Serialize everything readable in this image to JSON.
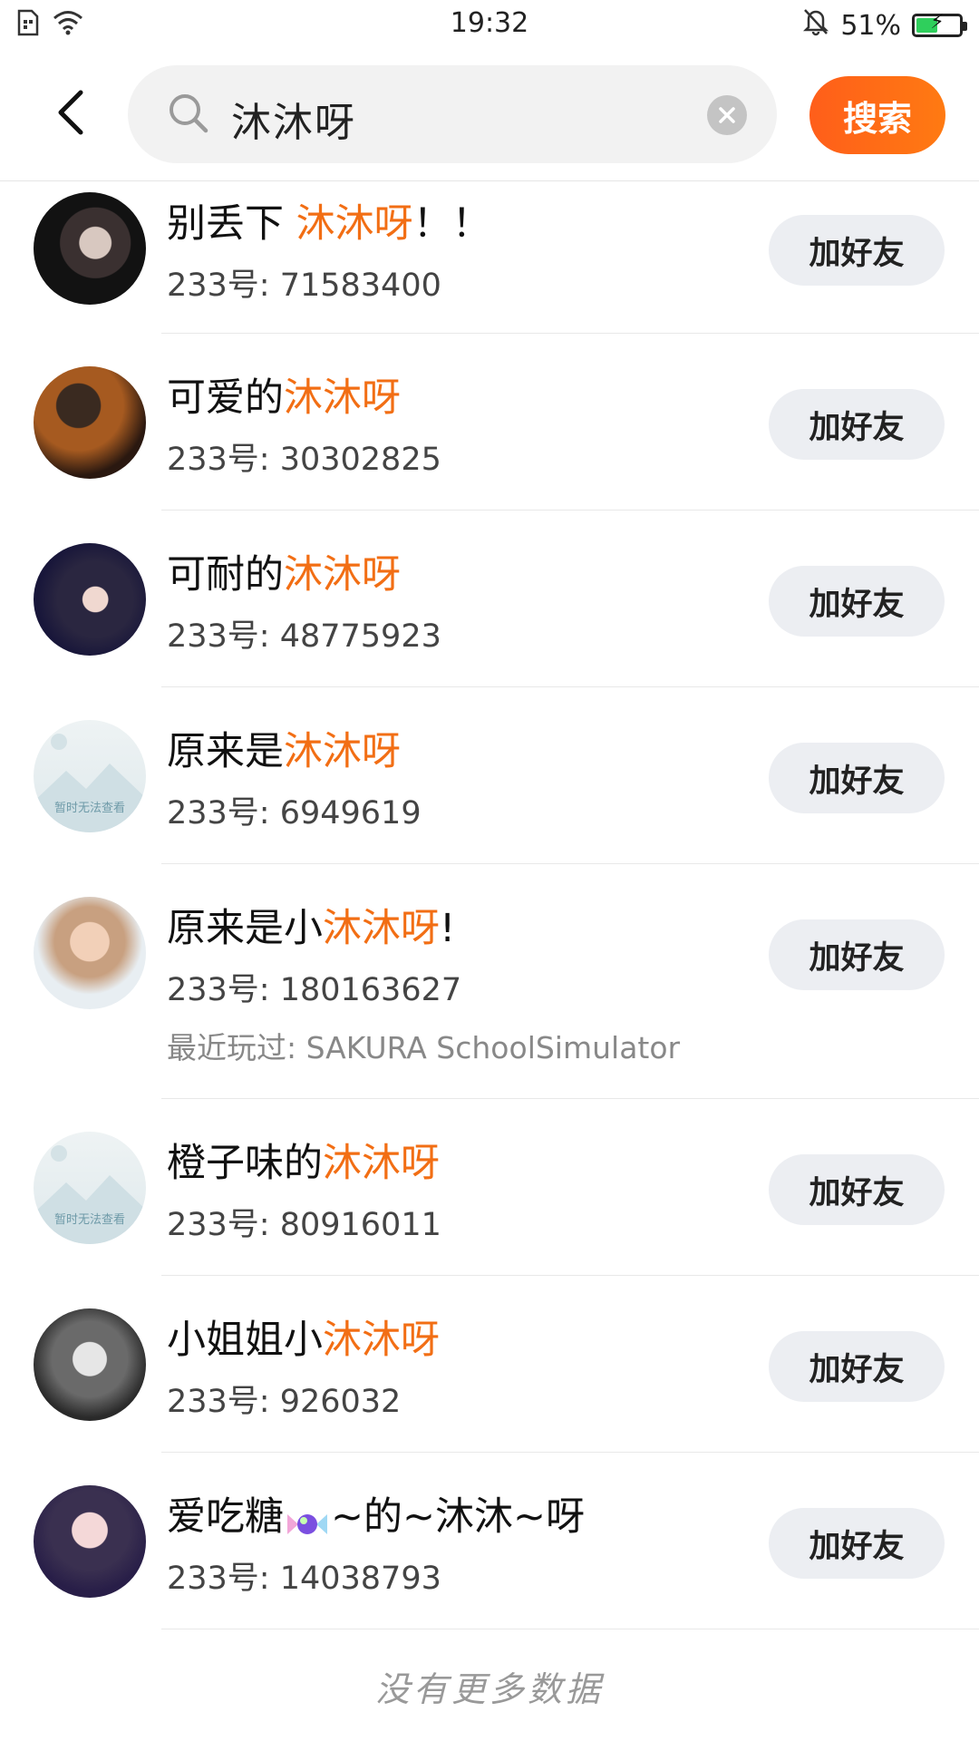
{
  "status_bar": {
    "time": "19:32",
    "battery_percent_label": "51%",
    "battery_level": 0.51
  },
  "header": {
    "search_value": "沐沐呀",
    "search_button": "搜索"
  },
  "add_friend_label": "加好友",
  "results": [
    {
      "name_before": "别丢下 ",
      "name_highlight": "沐沐呀",
      "name_after": "！！",
      "uid": "233号: 71583400"
    },
    {
      "name_before": "可爱的",
      "name_highlight": "沐沐呀",
      "name_after": "",
      "uid": "233号: 30302825"
    },
    {
      "name_before": "可耐的",
      "name_highlight": "沐沐呀",
      "name_after": "",
      "uid": "233号: 48775923"
    },
    {
      "name_before": "原来是",
      "name_highlight": "沐沐呀",
      "name_after": "",
      "uid": "233号: 6949619",
      "avatar_text": "暂时无法查看"
    },
    {
      "name_before": "原来是小",
      "name_highlight": "沐沐呀",
      "name_after": "!",
      "uid": "233号: 180163627",
      "recent": "最近玩过: SAKURA SchoolSimulator"
    },
    {
      "name_before": "橙子味的",
      "name_highlight": "沐沐呀",
      "name_after": "",
      "uid": "233号: 80916011",
      "avatar_text": "暂时无法查看"
    },
    {
      "name_before": "小姐姐小",
      "name_highlight": "沐沐呀",
      "name_after": "",
      "uid": "233号: 926032"
    },
    {
      "name_before": "爱吃糖",
      "name_highlight": "",
      "name_after": "~的~沐沐~呀",
      "uid": "233号: 14038793"
    }
  ],
  "footer": "没有更多数据",
  "colors": {
    "accent": "#f26e14",
    "button_bg": "#eceef2"
  }
}
